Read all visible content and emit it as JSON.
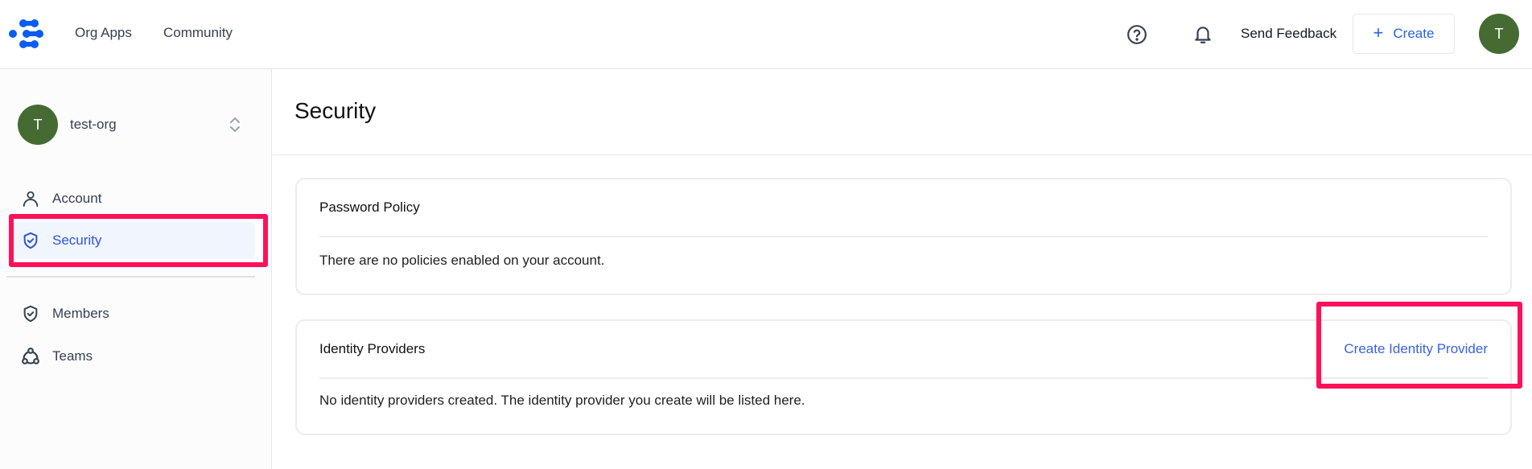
{
  "header": {
    "logo": "app-logo",
    "nav": [
      {
        "label": "Org Apps"
      },
      {
        "label": "Community"
      }
    ],
    "help_icon": "help-circle-icon",
    "notifications_icon": "bell-icon",
    "feedback_label": "Send Feedback",
    "create_label": "Create",
    "create_icon": "+",
    "user_avatar_initial": "T"
  },
  "sidebar": {
    "org": {
      "avatar_initial": "T",
      "name": "test-org",
      "switch_icon": "chevron-up-down-icon"
    },
    "items": [
      {
        "label": "Account",
        "icon": "user-icon",
        "active": false
      },
      {
        "label": "Security",
        "icon": "shield-check-icon",
        "active": true
      },
      {
        "label": "Members",
        "icon": "shield-check-icon",
        "active": false
      },
      {
        "label": "Teams",
        "icon": "team-icon",
        "active": false
      }
    ]
  },
  "main": {
    "title": "Security",
    "cards": [
      {
        "title": "Password Policy",
        "body": "There are no policies enabled on your account."
      },
      {
        "title": "Identity Providers",
        "action_label": "Create Identity Provider",
        "body": "No identity providers created. The identity provider you create will be listed here."
      }
    ]
  },
  "colors": {
    "accent": "#2563eb",
    "avatar": "#456b33",
    "highlight": "#fe1159",
    "active_item_bg": "#f1f5fe"
  }
}
